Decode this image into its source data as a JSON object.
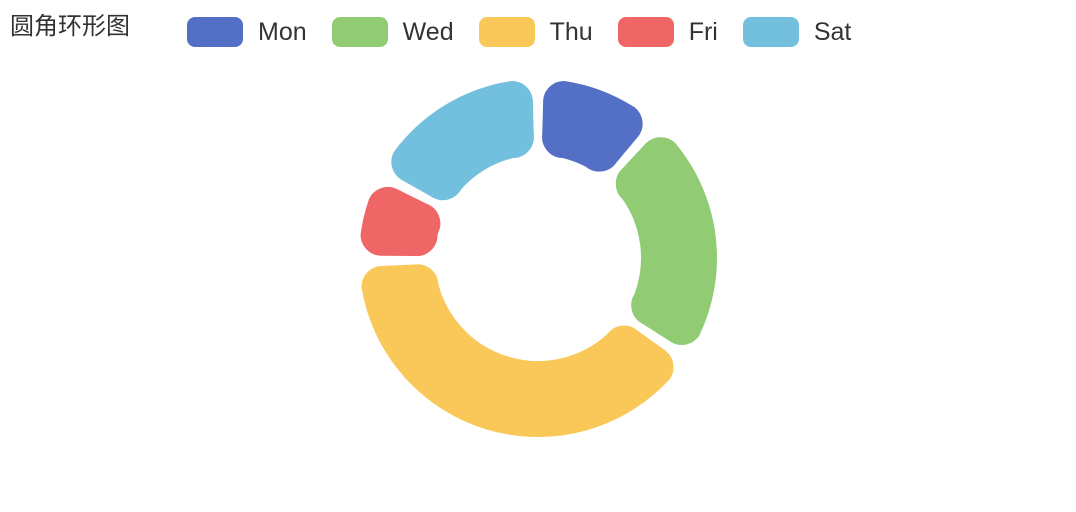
{
  "title": "圆角环形图",
  "colors": [
    "#5470c6",
    "#91cc75",
    "#fac858",
    "#ee6666",
    "#73c0de"
  ],
  "chart_data": {
    "type": "pie",
    "title": "圆角环形图",
    "legend_position": "top",
    "donut": true,
    "rounded_corners": true,
    "categories": [
      "Mon",
      "Wed",
      "Thu",
      "Fri",
      "Sat"
    ],
    "values": [
      10,
      20,
      35,
      7,
      15
    ],
    "series": [
      {
        "values": [
          10,
          20,
          35,
          7,
          15
        ]
      }
    ]
  }
}
